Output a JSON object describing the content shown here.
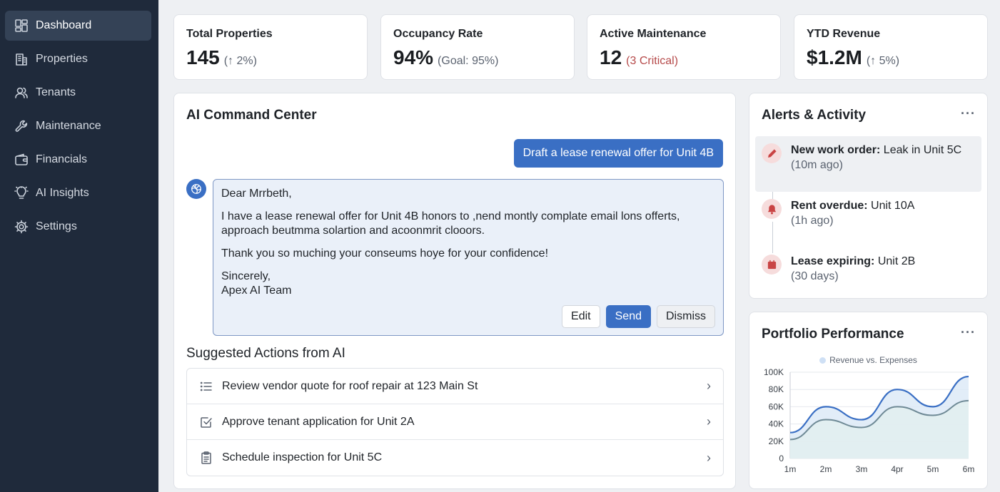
{
  "sidebar": {
    "items": [
      {
        "label": "Dashboard",
        "icon": "dashboard-icon",
        "active": true
      },
      {
        "label": "Properties",
        "icon": "building-icon"
      },
      {
        "label": "Tenants",
        "icon": "users-icon"
      },
      {
        "label": "Maintenance",
        "icon": "wrench-icon"
      },
      {
        "label": "Financials",
        "icon": "wallet-icon"
      },
      {
        "label": "AI Insights",
        "icon": "lightbulb-icon"
      },
      {
        "label": "Settings",
        "icon": "gear-icon"
      }
    ]
  },
  "stats": [
    {
      "title": "Total Properties",
      "value": "145",
      "sub": "(↑ 2%)"
    },
    {
      "title": "Occupancy Rate",
      "value": "94%",
      "sub": "(Goal: 95%)"
    },
    {
      "title": "Active Maintenance",
      "value": "12",
      "sub": "(3 Critical)"
    },
    {
      "title": "YTD Revenue",
      "value": "$1.2M",
      "sub": "(↑ 5%)"
    }
  ],
  "command_center": {
    "title": "AI Command Center",
    "prompt": "Draft a lease renewal offer for Unit 4B",
    "draft": {
      "greeting": "Dear Mrrbeth,",
      "body1": "I have a lease renewal offer for Unit 4B honors to ,nend montly complate email lons offerts, approach beutmma solartion and acoonmrit clooors.",
      "body2": "Thank you so muching your conseums hoye for your confidence!",
      "closing": "Sincerely,",
      "signature": "Apex AI Team"
    },
    "buttons": {
      "edit": "Edit",
      "send": "Send",
      "dismiss": "Dismiss"
    },
    "suggested_title": "Suggested Actions from AI",
    "suggested": [
      {
        "label": "Review vendor quote for roof repair at 123 Main St",
        "icon": "list-icon"
      },
      {
        "label": "Approve tenant application for Unit 2A",
        "icon": "checkbox-icon"
      },
      {
        "label": "Schedule inspection for Unit 5C",
        "icon": "clipboard-icon"
      }
    ]
  },
  "alerts": {
    "title": "Alerts & Activity",
    "more": "···",
    "items": [
      {
        "bold": "New work order:",
        "text": " Leak in Unit 5C",
        "time": "(10m ago)",
        "icon": "pencil-icon"
      },
      {
        "bold": "Rent overdue:",
        "text": " Unit 10A",
        "time": "(1h ago)",
        "icon": "bell-icon"
      },
      {
        "bold": "Lease expiring:",
        "text": " Unit 2B",
        "time": "(30 days)",
        "icon": "calendar-icon"
      }
    ]
  },
  "portfolio": {
    "title": "Portfolio Performance",
    "more": "···",
    "legend": "Revenue vs. Expenses"
  },
  "chart_data": {
    "type": "area",
    "categories": [
      "1m",
      "2m",
      "3m",
      "4pr",
      "5m",
      "6m"
    ],
    "series": [
      {
        "values": [
          30,
          60,
          45,
          80,
          60,
          95
        ],
        "color": "#3a6fc4"
      },
      {
        "values": [
          22,
          45,
          36,
          60,
          50,
          67
        ],
        "color": "#6f8a96"
      }
    ],
    "y_ticks": [
      "100K",
      "80K",
      "60K",
      "40K",
      "20K",
      "0"
    ],
    "ylim": [
      0,
      100
    ],
    "grid": true
  }
}
